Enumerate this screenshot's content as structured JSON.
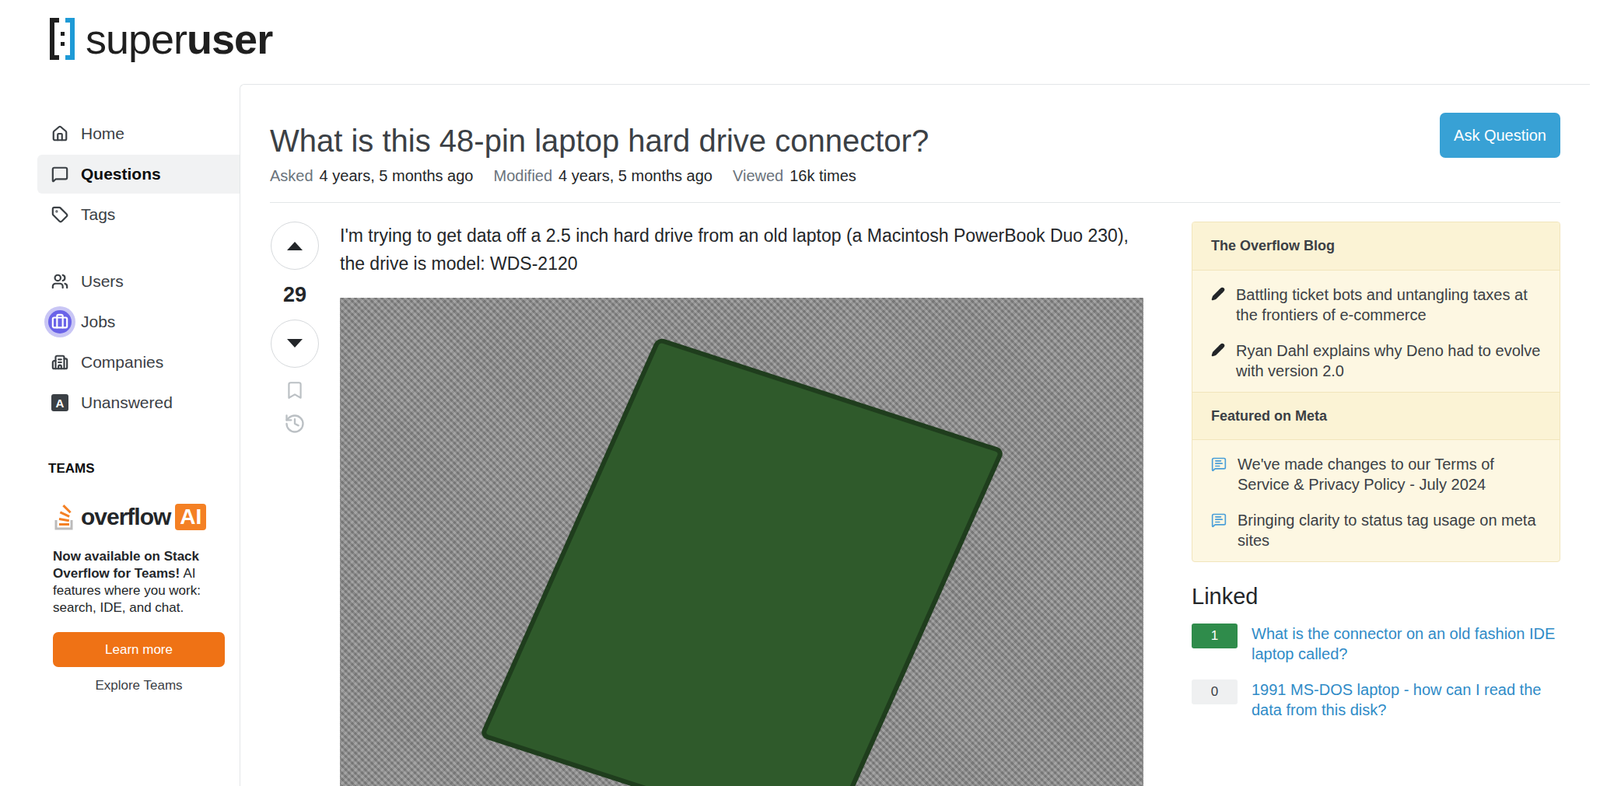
{
  "logo": {
    "light": "super",
    "bold": "user"
  },
  "sidebar": {
    "groups": [
      [
        {
          "label": "Home",
          "selected": false,
          "highlighted": false
        },
        {
          "label": "Questions",
          "selected": true,
          "highlighted": false
        },
        {
          "label": "Tags",
          "selected": false,
          "highlighted": false
        }
      ],
      [
        {
          "label": "Users",
          "selected": false,
          "highlighted": false
        },
        {
          "label": "Jobs",
          "selected": false,
          "highlighted": true
        },
        {
          "label": "Companies",
          "selected": false,
          "highlighted": false
        },
        {
          "label": "Unanswered",
          "selected": false,
          "highlighted": false,
          "icon_text": "A"
        }
      ]
    ]
  },
  "teams": {
    "heading": "TEAMS",
    "logo_main": "overflow",
    "logo_badge": "AI",
    "lead": "Now available on Stack Overflow for Teams!",
    "text": "AI features where you work: search, IDE, and chat.",
    "button": "Learn more",
    "link": "Explore Teams"
  },
  "question": {
    "title": "What is this 48-pin laptop hard drive connector?",
    "meta": [
      {
        "label": "Asked",
        "value": "4 years, 5 months ago"
      },
      {
        "label": "Modified",
        "value": "4 years, 5 months ago"
      },
      {
        "label": "Viewed",
        "value": "16k times"
      }
    ],
    "votes": "29",
    "body": "I'm trying to get data off a 2.5 inch hard drive from an old laptop (a Macintosh PowerBook Duo 230), the drive is model: WDS-2120"
  },
  "ask_button": "Ask Question",
  "blog": {
    "title": "The Overflow Blog",
    "items": [
      "Battling ticket bots and untangling taxes at the frontiers of e-commerce",
      "Ryan Dahl explains why Deno had to evolve with version 2.0"
    ]
  },
  "meta_feature": {
    "title": "Featured on Meta",
    "items": [
      "We've made changes to our Terms of Service & Privacy Policy - July 2024",
      "Bringing clarity to status tag usage on meta sites"
    ]
  },
  "linked": {
    "title": "Linked",
    "items": [
      {
        "count": "1",
        "accepted": true,
        "text": "What is the connector on an old fashion IDE laptop called?"
      },
      {
        "count": "0",
        "accepted": false,
        "text": "1991 MS-DOS laptop - how can I read the data from this disk?"
      }
    ]
  }
}
